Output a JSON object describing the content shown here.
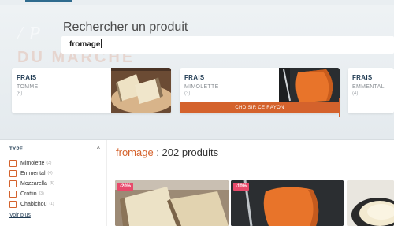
{
  "search": {
    "title": "Rechercher un produit",
    "query": "fromage",
    "background_watermark": [
      "/ P",
      "DU MARCHÉ"
    ]
  },
  "rayons": [
    {
      "kicker": "FRAIS",
      "name": "TOMME",
      "count": "(6)"
    },
    {
      "kicker": "FRAIS",
      "name": "MIMOLETTE",
      "count": "(3)",
      "action": "CHOISIR CE RAYON"
    },
    {
      "kicker": "FRAIS",
      "name": "EMMENTAL",
      "count": "(4)"
    }
  ],
  "filter": {
    "title": "TYPE",
    "options": [
      {
        "label": "Mimolette",
        "count": "(3)"
      },
      {
        "label": "Emmental",
        "count": "(4)"
      },
      {
        "label": "Mozzarella",
        "count": "(5)"
      },
      {
        "label": "Crottin",
        "count": "(3)"
      },
      {
        "label": "Chabichou",
        "count": "(1)"
      }
    ],
    "more": "Voir plus"
  },
  "results": {
    "query": "fromage",
    "count_text": " : 202 produits"
  },
  "products": [
    {
      "badge": "-20%"
    },
    {
      "badge": "-10%"
    },
    {
      "badge": ""
    }
  ],
  "colors": {
    "accent": "#d4622c",
    "navy": "#1f3a52",
    "promo": "#e84a6b"
  }
}
